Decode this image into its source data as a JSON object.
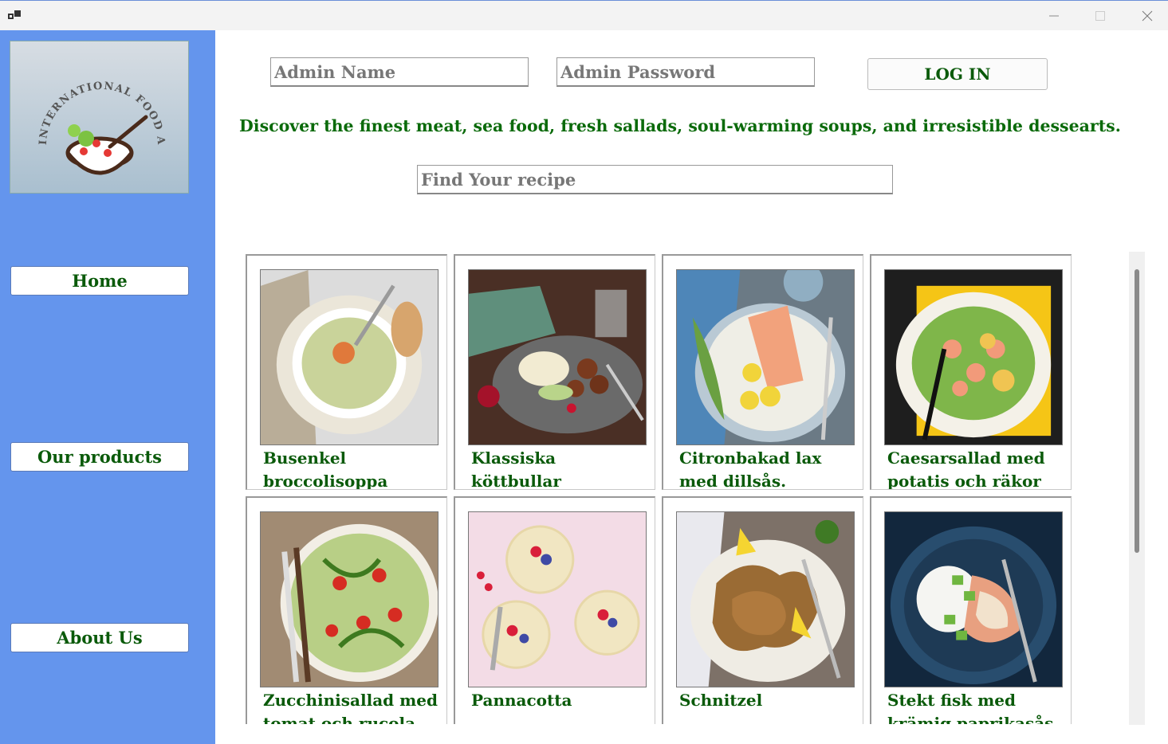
{
  "window": {
    "minimize_icon": "minimize-icon",
    "maximize_icon": "maximize-icon",
    "close_icon": "close-icon"
  },
  "sidebar": {
    "logo_text": "INTERNATIONAL FOOD AB",
    "items": [
      {
        "label": "Home"
      },
      {
        "label": "Our products"
      },
      {
        "label": "About Us"
      }
    ]
  },
  "login": {
    "name_placeholder": "Admin Name",
    "password_placeholder": "Admin Password",
    "button_label": "LOG IN"
  },
  "tagline": "Discover the finest meat, sea food, fresh sallads, soul-warming soups, and irresistible dessearts.",
  "search": {
    "placeholder": "Find Your recipe"
  },
  "recipes": [
    {
      "title": "Busenkel broccolisoppa"
    },
    {
      "title": "Klassiska köttbullar"
    },
    {
      "title": "Citronbakad lax med dillsås."
    },
    {
      "title": "Caesarsallad med potatis och räkor"
    },
    {
      "title": "Zucchinisallad med tomat och rucola"
    },
    {
      "title": "Pannacotta"
    },
    {
      "title": "Schnitzel"
    },
    {
      "title": "Stekt fisk med krämig paprikasås"
    }
  ],
  "colors": {
    "sidebar": "#6495ed",
    "text_green": "#0a5a0a"
  }
}
